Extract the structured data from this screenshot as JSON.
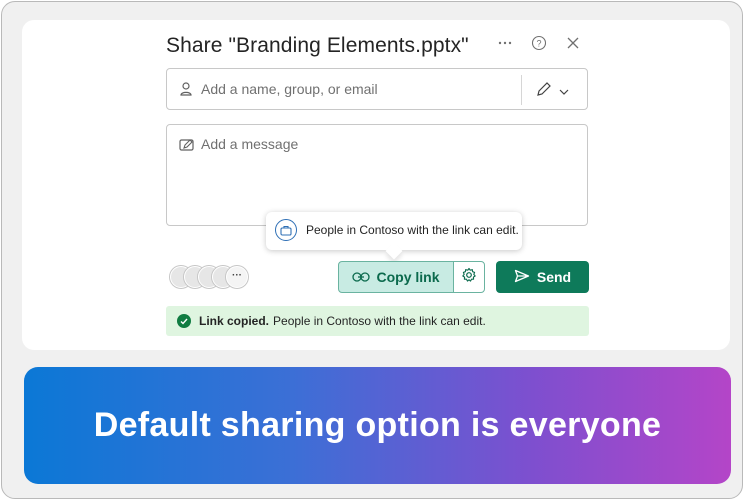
{
  "dialog": {
    "title": "Share \"Branding Elements.pptx\"",
    "more_label": "···",
    "help_label": "?",
    "close_label": "✕",
    "recipients_input": {
      "placeholder": "Add a name, group, or email"
    },
    "message_input": {
      "placeholder": "Add a message"
    },
    "tooltip": {
      "text": "People in Contoso with the link can edit."
    },
    "avatars": {
      "more_label": "···"
    },
    "buttons": {
      "copy_link": "Copy link",
      "send": "Send"
    },
    "banner": {
      "bold": "Link copied.",
      "text": "People in Contoso with the link can edit."
    }
  },
  "caption": {
    "text": "Default sharing option is everyone"
  },
  "colors": {
    "primary_green": "#0e7a5a",
    "copy_bg": "#c8ebe3",
    "banner_bg": "#dff5e0",
    "gradient_start": "#0b78d6",
    "gradient_end": "#b445c8"
  },
  "icons": [
    "more-icon",
    "help-icon",
    "close-icon",
    "person-icon",
    "pencil-icon",
    "chevron-down-icon",
    "edit-message-icon",
    "briefcase-icon",
    "link-icon",
    "gear-icon",
    "send-icon",
    "check-icon"
  ]
}
